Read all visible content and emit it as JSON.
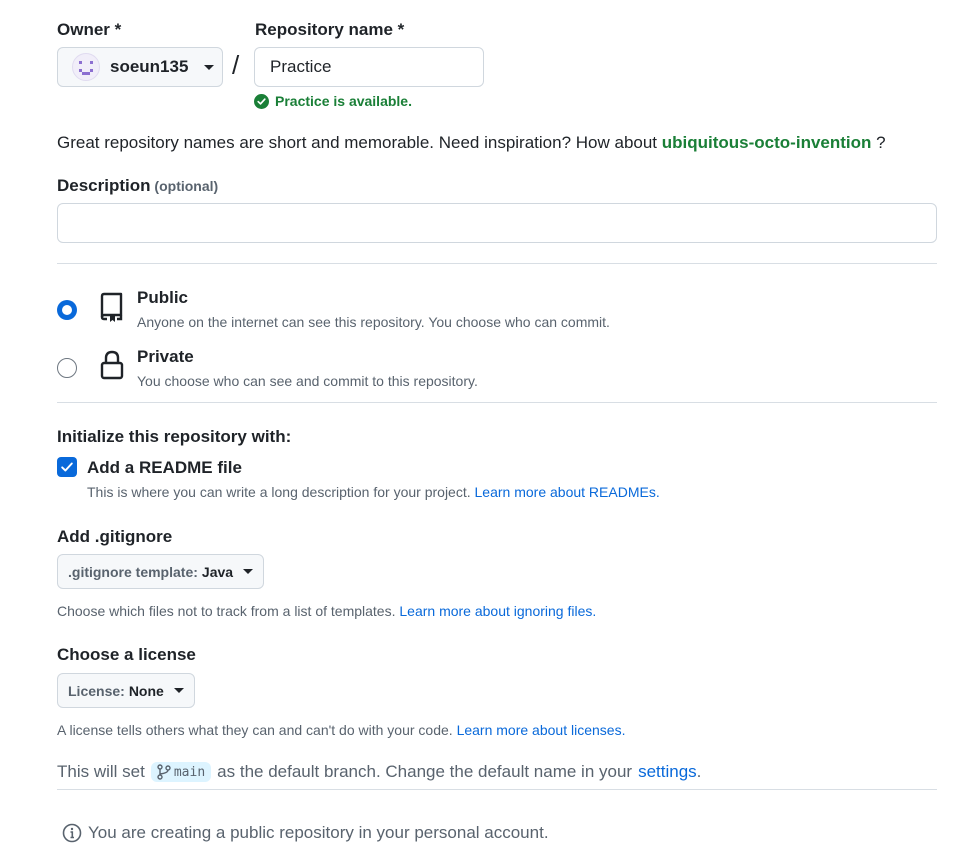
{
  "owner": {
    "label": "Owner",
    "required_mark": "*",
    "value": "soeun135"
  },
  "separator": "/",
  "repo_name": {
    "label": "Repository name",
    "required_mark": "*",
    "value": "Practice",
    "status": "Practice is available."
  },
  "inspiration": {
    "text": "Great repository names are short and memorable. Need inspiration? How about",
    "suggestion": "ubiquitous-octo-invention",
    "end": "?"
  },
  "description": {
    "label": "Description",
    "optional": "(optional)",
    "value": ""
  },
  "visibility": {
    "public": {
      "title": "Public",
      "desc": "Anyone on the internet can see this repository. You choose who can commit.",
      "selected": true
    },
    "private": {
      "title": "Private",
      "desc": "You choose who can see and commit to this repository.",
      "selected": false
    }
  },
  "init": {
    "heading": "Initialize this repository with:",
    "readme_label": "Add a README file",
    "readme_checked": true,
    "readme_help": "This is where you can write a long description for your project.",
    "readme_link": "Learn more about READMEs."
  },
  "gitignore": {
    "heading": "Add .gitignore",
    "button_prefix": ".gitignore template:",
    "button_value": "Java",
    "help": "Choose which files not to track from a list of templates.",
    "link": "Learn more about ignoring files."
  },
  "license": {
    "heading": "Choose a license",
    "button_prefix": "License:",
    "button_value": "None",
    "help": "A license tells others what they can and can't do with your code.",
    "link": "Learn more about licenses."
  },
  "branch": {
    "text_before": "This will set",
    "branch_name": "main",
    "text_after": "as the default branch. Change the default name in your",
    "link": "settings",
    "end": "."
  },
  "notice": {
    "text": "You are creating a public repository in your personal account."
  },
  "colors": {
    "accent": "#0969da",
    "success": "#1a7f37",
    "border": "#d0d7de"
  }
}
